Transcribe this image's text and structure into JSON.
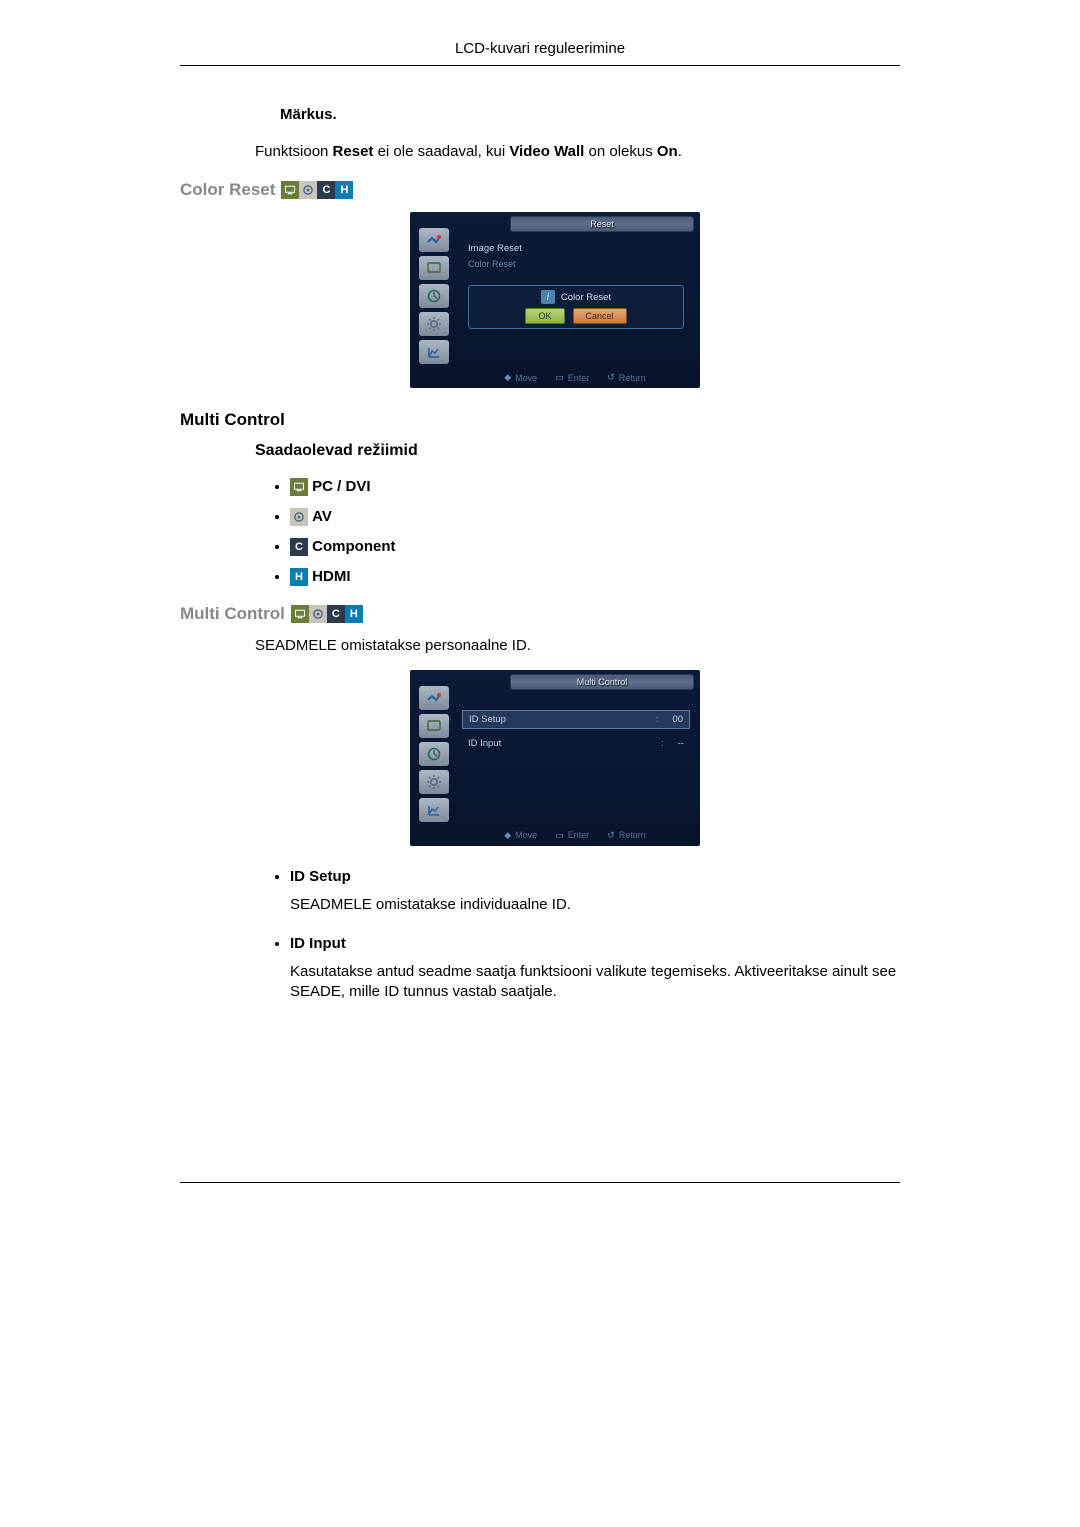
{
  "header": {
    "title": "LCD-kuvari reguleerimine"
  },
  "note": {
    "label": "Märkus.",
    "text_before": "Funktsioon ",
    "reset": "Reset",
    "text_mid1": " ei ole saadaval, kui ",
    "videowall": "Video Wall",
    "text_mid2": " on olekus ",
    "on": "On",
    "text_after": "."
  },
  "sections": {
    "color_reset": "Color Reset",
    "multi_control_h": "Multi Control",
    "multi_control_sub": "Multi Control",
    "available_modes": "Saadaolevad režiimid"
  },
  "modes": {
    "pcdvi": "PC / DVI",
    "av": "AV",
    "component": "Component",
    "hdmi": "HDMI"
  },
  "multi_control": {
    "intro": "SEADMELE omistatakse personaalne ID.",
    "items": [
      {
        "title": "ID Setup",
        "desc": "SEADMELE omistatakse individuaalne ID."
      },
      {
        "title": "ID Input",
        "desc": "Kasutatakse antud seadme saatja funktsiooni valikute tegemiseks. Aktiveeritakse ainult see SEADE, mille ID tunnus vastab saatjale."
      }
    ]
  },
  "osd1": {
    "title": "Reset",
    "row1": "Image Reset",
    "row2": "Color Reset",
    "dialog_title": "Color Reset",
    "ok": "OK",
    "cancel": "Cancel",
    "move": "Move",
    "enter": "Enter",
    "return": "Return"
  },
  "osd2": {
    "title": "Multi Control",
    "r1l": "ID Setup",
    "r1c": ":",
    "r1v": "00",
    "r2l": "ID Input",
    "r2c": ":",
    "r2v": "--",
    "move": "Move",
    "enter": "Enter",
    "return": "Return"
  }
}
